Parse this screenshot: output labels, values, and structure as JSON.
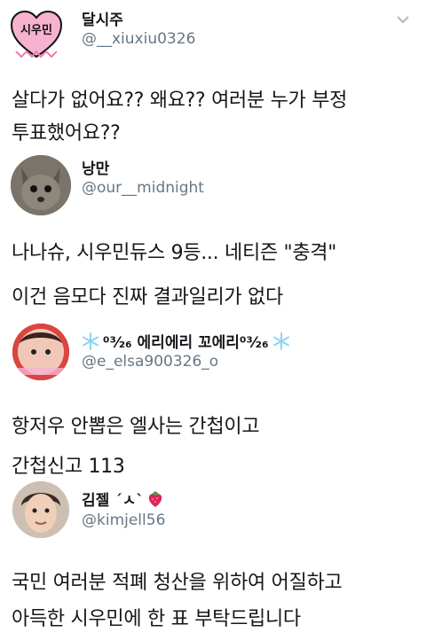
{
  "tweets": [
    {
      "name": "달시주",
      "handle": "@__xiuxiu0326",
      "avatar_text": "시우민",
      "lines": [
        "살다가 없어요?? 왜요?? 여러분 누가 부정",
        "투표했어요??"
      ]
    },
    {
      "name": "낭만",
      "handle": "@our__midnight",
      "lines": [
        "나나슈, 시우민듀스 9등... 네티즌 \"충격\"",
        "이건 음모다 진짜 결과일리가 없다"
      ]
    },
    {
      "name": "⁰³⁄₂₆ 에리에리 꼬에리⁰³⁄₂₆",
      "handle": "@e_elsa900326_o",
      "lines": [
        "항저우 안뽑은 엘사는 간첩이고",
        "간첩신고 113"
      ]
    },
    {
      "name": "김젤 ˊㅅˋ",
      "handle": "@kimjell56",
      "lines": [
        "국민 여러분 적폐 청산을 위하여 어질하고",
        "아득한 시우민에 한 표 부탁드립니다"
      ]
    }
  ],
  "icons": [
    "chevron-down-icon",
    "snowflake-icon",
    "strawberry-icon",
    "heart-icon"
  ],
  "colors": {
    "text": "#14171a",
    "handle": "#657786",
    "snowflake": "#8fd3f4",
    "strawberry": "#e0245e",
    "heart_badge": "#f7b2d0"
  }
}
